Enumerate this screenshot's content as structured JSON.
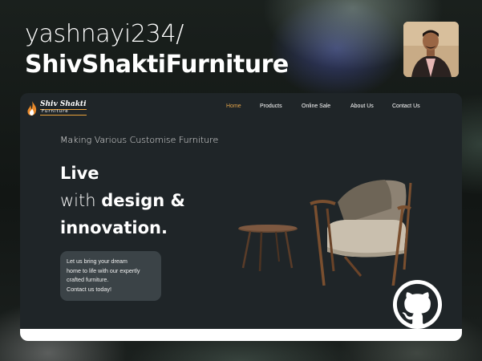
{
  "repo": {
    "owner": "yashnayi234/",
    "name": "ShivShaktiFurniture"
  },
  "site": {
    "logo": {
      "main": "Shiv Shakti",
      "sub": "Furniture"
    },
    "nav": [
      {
        "label": "Home",
        "active": true
      },
      {
        "label": "Products",
        "active": false
      },
      {
        "label": "Online Sale",
        "active": false
      },
      {
        "label": "About Us",
        "active": false
      },
      {
        "label": "Contact Us",
        "active": false
      }
    ],
    "tagline": "Making Various Customise Furniture",
    "headline": {
      "line1": "Live",
      "line2_light": "with ",
      "line2_bold": "design &",
      "line3": "innovation."
    },
    "cta_lines": [
      "Let us bring your dream",
      "home to life with our expertly",
      "crafted furniture.",
      "Contact us today!"
    ]
  },
  "colors": {
    "accent": "#e3a44a",
    "card_bg": "#1f2528",
    "cta_bg": "#3b4347"
  },
  "icons": {
    "github": "github-icon",
    "logo": "flame-logo-icon"
  }
}
